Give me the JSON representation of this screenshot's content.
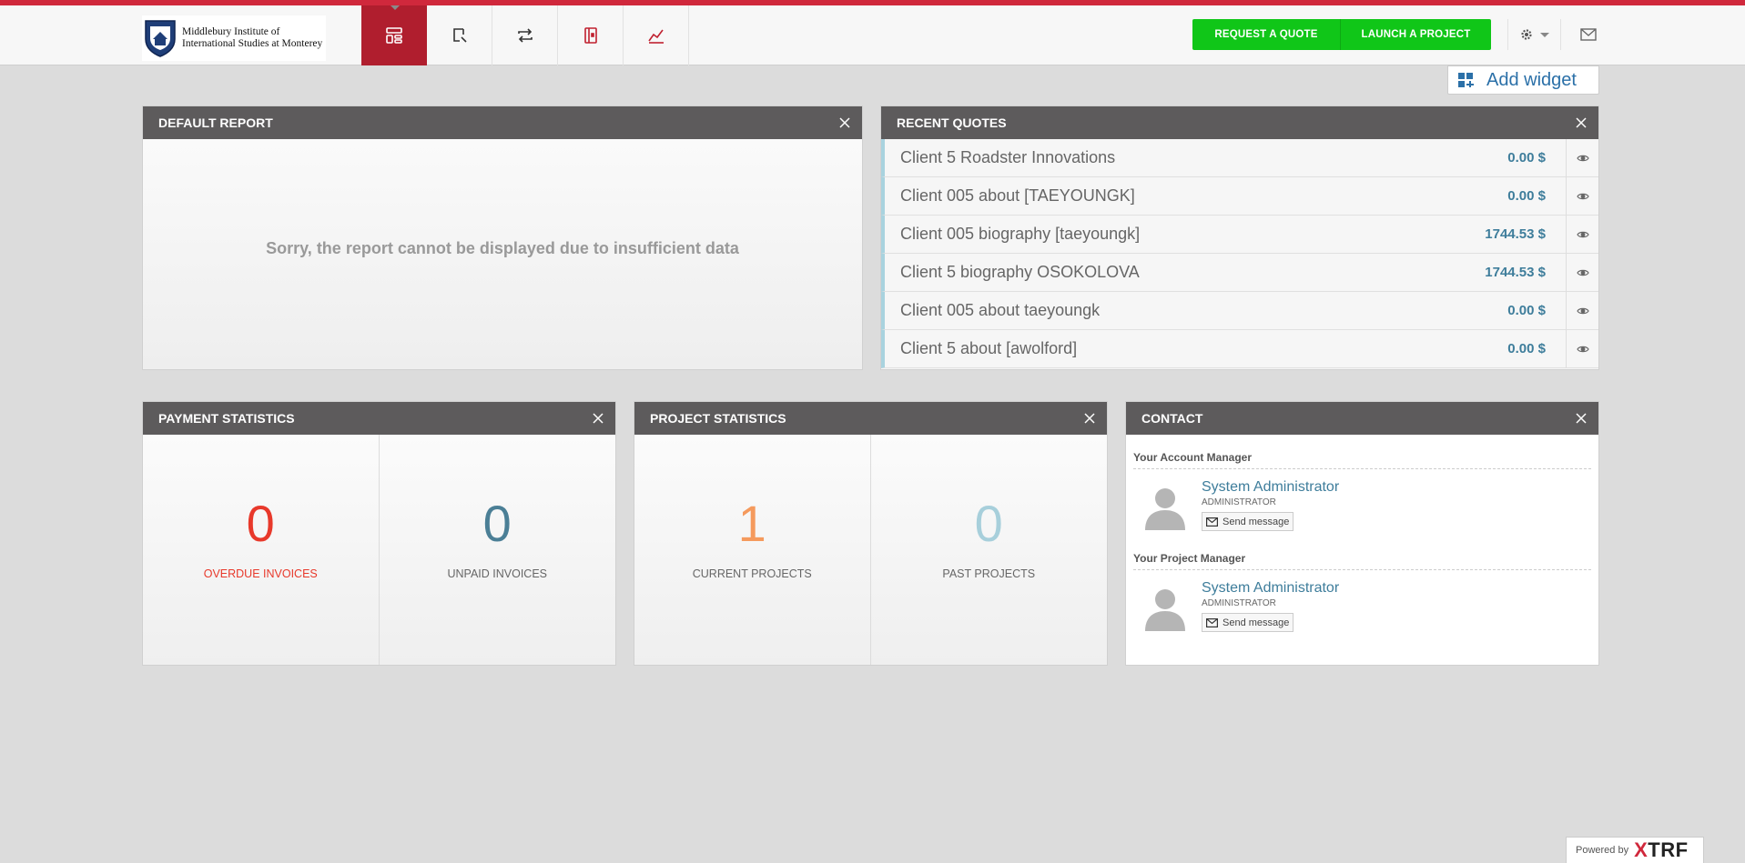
{
  "header": {
    "logo_line1": "Middlebury Institute of",
    "logo_line2": "International Studies at Monterey",
    "nav": [
      {
        "icon": "dashboard-icon",
        "active": true
      },
      {
        "icon": "quote-search-icon",
        "active": false
      },
      {
        "icon": "projects-cycle-icon",
        "active": false
      },
      {
        "icon": "invoices-book-icon",
        "active": false
      },
      {
        "icon": "reports-chart-icon",
        "active": false
      }
    ],
    "request_quote": "REQUEST A QUOTE",
    "launch_project": "LAUNCH A PROJECT",
    "settings_icon": "gear-icon",
    "mail_icon": "envelope-icon",
    "accent_color": "#d0283c",
    "green_color": "#10c618"
  },
  "add_widget": {
    "label": "Add widget"
  },
  "default_report": {
    "title": "DEFAULT REPORT",
    "message": "Sorry, the report cannot be displayed due to insufficient data"
  },
  "recent_quotes": {
    "title": "RECENT QUOTES",
    "items": [
      {
        "name": "Client 5 Roadster Innovations",
        "amount": "0.00 $"
      },
      {
        "name": "Client 005 about [TAEYOUNGK]",
        "amount": "0.00 $"
      },
      {
        "name": "Client 005 biography [taeyoungk]",
        "amount": "1744.53 $"
      },
      {
        "name": "Client 5 biography OSOKOLOVA",
        "amount": "1744.53 $"
      },
      {
        "name": "Client 005 about taeyoungk",
        "amount": "0.00 $"
      },
      {
        "name": "Client 5 about [awolford]",
        "amount": "0.00 $"
      }
    ]
  },
  "payment_statistics": {
    "title": "PAYMENT STATISTICS",
    "overdue": {
      "value": "0",
      "label": "OVERDUE INVOICES",
      "color": "#e8392b"
    },
    "unpaid": {
      "value": "0",
      "label": "UNPAID INVOICES",
      "color": "#4b7f96"
    }
  },
  "project_statistics": {
    "title": "PROJECT STATISTICS",
    "current": {
      "value": "1",
      "label": "CURRENT PROJECTS",
      "color": "#f59a5d"
    },
    "past": {
      "value": "0",
      "label": "PAST PROJECTS",
      "color": "#a7cfdb"
    }
  },
  "contact": {
    "title": "CONTACT",
    "account_manager_label": "Your Account Manager",
    "project_manager_label": "Your Project Manager",
    "account_manager": {
      "name": "System Administrator",
      "role": "ADMINISTRATOR",
      "send": "Send message"
    },
    "project_manager": {
      "name": "System Administrator",
      "role": "ADMINISTRATOR",
      "send": "Send message"
    }
  },
  "footer": {
    "powered_by": "Powered by",
    "brand_x": "X",
    "brand_rest": "TRF"
  }
}
